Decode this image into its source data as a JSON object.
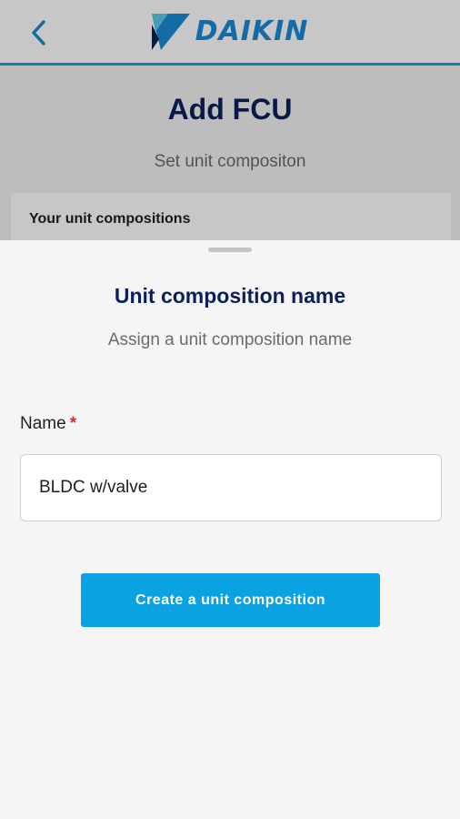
{
  "header": {
    "back_icon": "chevron-left-icon",
    "logo_text": "DAIKIN",
    "logo_icon": "daikin-triangle-logo",
    "accent_color": "#1a9fd9"
  },
  "page": {
    "title": "Add FCU",
    "subtitle": "Set unit compositon",
    "compositions_label": "Your unit compositions"
  },
  "sheet": {
    "title": "Unit composition name",
    "subtitle": "Assign a unit composition name",
    "name_label": "Name",
    "required_marker": "*",
    "name_value": "BLDC w/valve",
    "create_button_label": "Create a unit composition",
    "button_color": "#0ba2e4"
  }
}
